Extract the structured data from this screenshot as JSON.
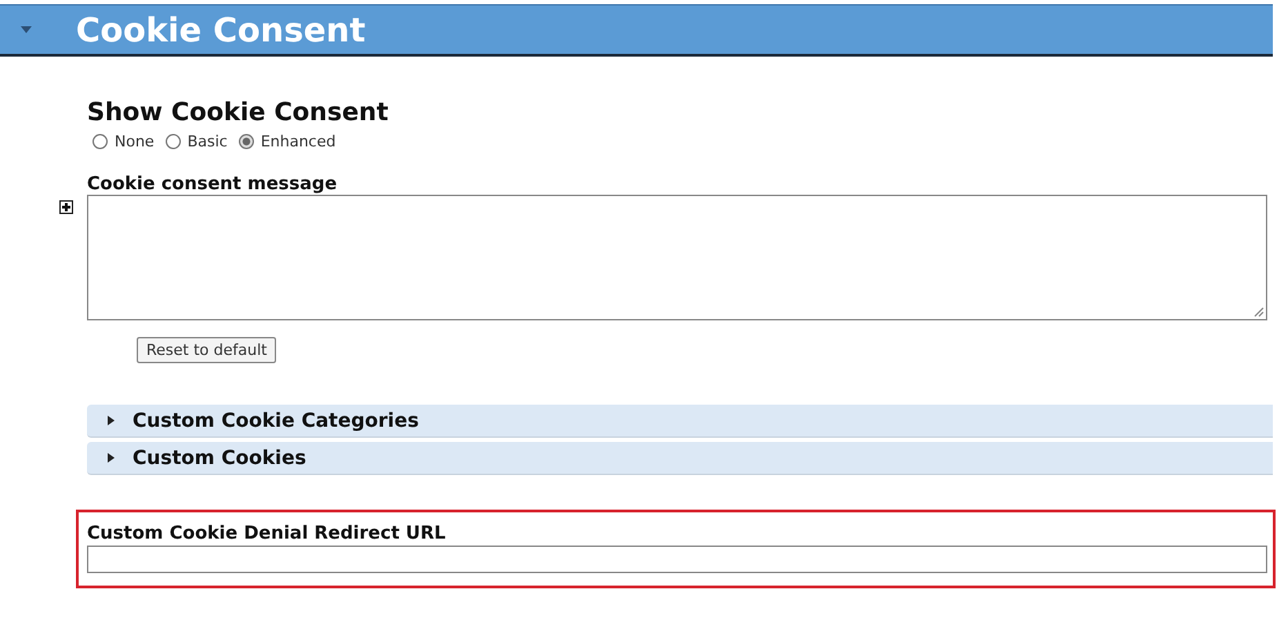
{
  "header": {
    "title": "Cookie Consent",
    "expanded": true
  },
  "show_consent": {
    "label": "Show Cookie Consent",
    "options": [
      {
        "label": "None",
        "selected": false
      },
      {
        "label": "Basic",
        "selected": false
      },
      {
        "label": "Enhanced",
        "selected": true
      }
    ]
  },
  "message": {
    "label": "Cookie consent message",
    "reset_button": "Reset to default"
  },
  "sections": [
    {
      "label": "Custom Cookie Categories",
      "expanded": false
    },
    {
      "label": "Custom Cookies",
      "expanded": false
    }
  ],
  "redirect": {
    "label": "Custom Cookie Denial Redirect URL",
    "highlighted": true
  }
}
